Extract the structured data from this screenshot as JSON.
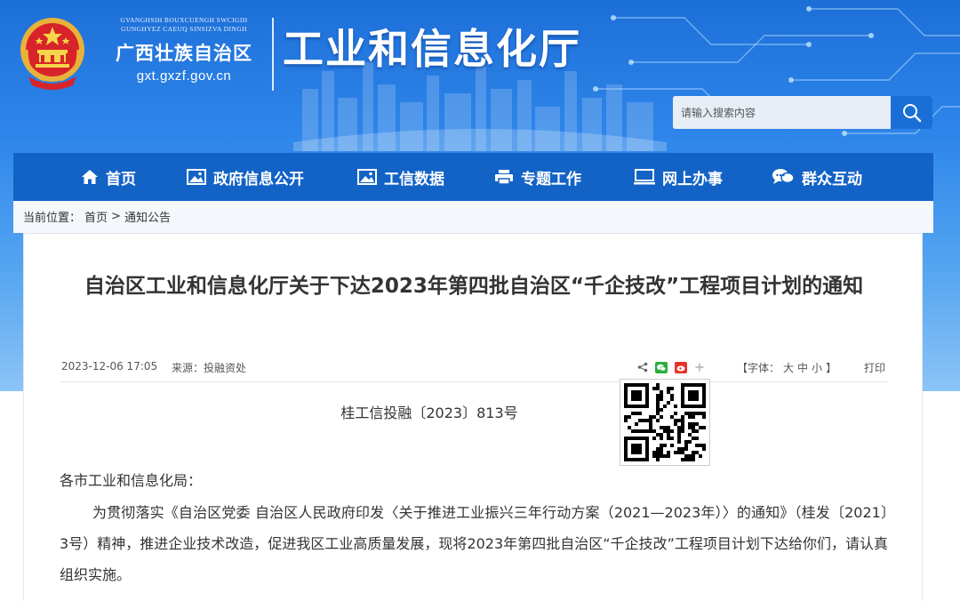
{
  "header": {
    "org_latin_line1": "GVANGHSIH BOUXCUENGH SWCIGIH",
    "org_latin_line2": "GUNGHYEZ CAEUQ SINSIZVA DINGH",
    "org_name": "广西壮族自治区",
    "domain": "gxt.gxzf.gov.cn",
    "dept_title": "工业和信息化厅"
  },
  "search": {
    "placeholder": "请输入搜索内容"
  },
  "nav": {
    "items": [
      {
        "label": "首页",
        "icon": "home-icon"
      },
      {
        "label": "政府信息公开",
        "icon": "image-icon"
      },
      {
        "label": "工信数据",
        "icon": "image-icon"
      },
      {
        "label": "专题工作",
        "icon": "printer-icon"
      },
      {
        "label": "网上办事",
        "icon": "monitor-icon"
      },
      {
        "label": "群众互动",
        "icon": "chat-bubbles-icon"
      }
    ]
  },
  "breadcrumb": {
    "prefix": "当前位置：",
    "home": "首页",
    "separator": ">",
    "current": "通知公告"
  },
  "article": {
    "title": "自治区工业和信息化厅关于下达2023年第四批自治区“千企技改”工程项目计划的通知",
    "date": "2023-12-06 17:05",
    "source_label": "来源：",
    "source": "投融资处",
    "font_size_prefix": "【字体：",
    "font_large": "大",
    "font_medium": "中",
    "font_small": "小",
    "font_size_suffix": "】",
    "print": "打印",
    "doc_number": "桂工信投融〔2023〕813号",
    "recipient": "各市工业和信息化局：",
    "body": "为贯彻落实《自治区党委 自治区人民政府印发〈关于推进工业振兴三年行动方案（2021—2023年）〉的通知》（桂发〔2021〕3号）精神，推进企业技术改造，促进我区工业高质量发展，现将2023年第四批自治区“千企技改”工程项目计划下达给你们，请认真组织实施。"
  },
  "colors": {
    "nav_bg": "#1363c6",
    "header_top": "#1d6fd8",
    "search_button": "#1a6fd6",
    "text": "#333333"
  }
}
